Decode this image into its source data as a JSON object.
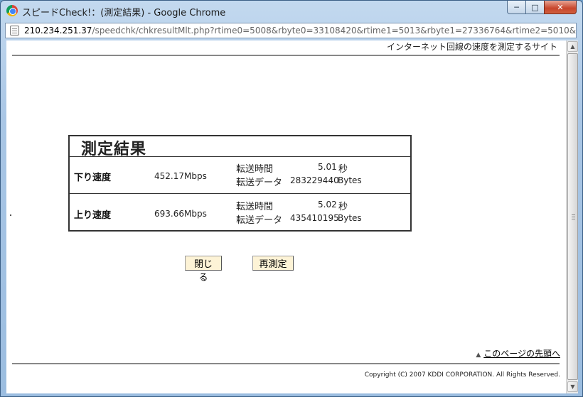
{
  "window": {
    "title": "スピードCheck!：(測定結果) - Google Chrome",
    "controls": {
      "minimize": "─",
      "maximize": "□",
      "close": "✕"
    }
  },
  "address": {
    "host": "210.234.251.37",
    "path": "/speedchk/chkresultMlt.php?rtime0=5008&rbyte0=33108420&rtime1=5013&rbyte1=27336764&rtime2=5010&rbyte2"
  },
  "page": {
    "tagline": "インターネット回線の速度を測定するサイト",
    "result": {
      "title": "測定結果",
      "rows": [
        {
          "label": "下り速度",
          "speed": "452.17Mbps",
          "time_label": "転送時間",
          "time_value": "5.01",
          "time_unit": "秒",
          "data_label": "転送データ",
          "data_value": "283229440",
          "data_unit": "Bytes"
        },
        {
          "label": "上り速度",
          "speed": "693.66Mbps",
          "time_label": "転送時間",
          "time_value": "5.02",
          "time_unit": "秒",
          "data_label": "転送データ",
          "data_value": "435410195",
          "data_unit": "Bytes"
        }
      ]
    },
    "buttons": {
      "close": "閉じる",
      "remeasure": "再測定"
    },
    "top_link": "このページの先頭へ",
    "copyright": "Copyright (C) 2007  KDDI CORPORATION. All Rights Reserved."
  },
  "scrollbar": {
    "up": "▲",
    "down": "▼"
  },
  "icons": {
    "top_link": "up-arrow-icon"
  }
}
